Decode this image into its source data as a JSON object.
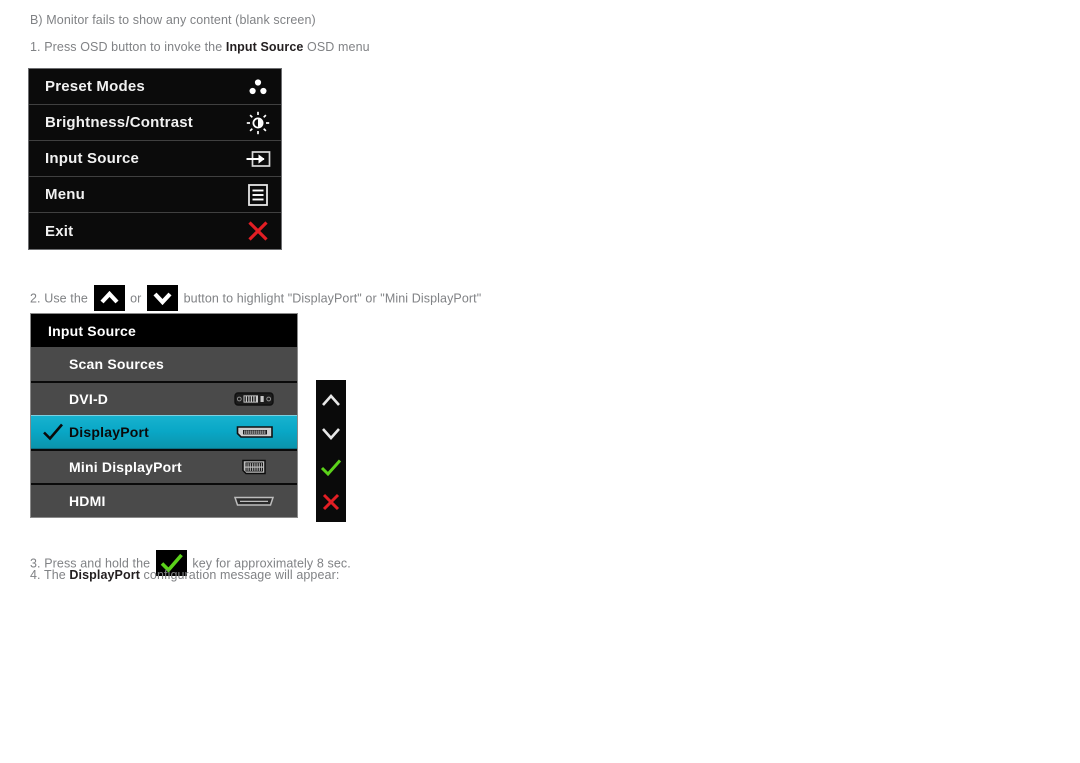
{
  "document": {
    "section_heading": "B) Monitor fails to show any content (blank screen)",
    "steps": {
      "step1": {
        "prefix": "1. Press OSD button to invoke the ",
        "bold": "Input Source",
        "suffix": " OSD menu"
      },
      "step2": {
        "prefix": "2. Use the ",
        "middle": " or ",
        "suffix": " button to highlight \"DisplayPort\" or \"Mini DisplayPort\""
      },
      "step3": {
        "prefix": "3. Press and hold the ",
        "suffix": " key for approximately 8 sec."
      },
      "step4": {
        "prefix": "4. The ",
        "bold": "DisplayPort",
        "suffix": " configuration message will appear:"
      }
    }
  },
  "osd_main_menu": {
    "items": [
      {
        "label": "Preset Modes",
        "icon": "preset-modes-icon"
      },
      {
        "label": "Brightness/Contrast",
        "icon": "brightness-contrast-icon"
      },
      {
        "label": "Input Source",
        "icon": "input-source-icon"
      },
      {
        "label": "Menu",
        "icon": "menu-lines-icon"
      },
      {
        "label": "Exit",
        "icon": "exit-x-icon"
      }
    ]
  },
  "input_source_menu": {
    "title": "Input Source",
    "items": [
      {
        "label": "Scan Sources",
        "connector": "none",
        "selected": false,
        "checked": false
      },
      {
        "label": "DVI-D",
        "connector": "dvi-d-icon",
        "selected": false,
        "checked": false
      },
      {
        "label": "DisplayPort",
        "connector": "displayport-icon",
        "selected": true,
        "checked": true
      },
      {
        "label": "Mini DisplayPort",
        "connector": "mini-displayport-icon",
        "selected": false,
        "checked": false
      },
      {
        "label": "HDMI",
        "connector": "hdmi-icon",
        "selected": false,
        "checked": false
      }
    ]
  },
  "key_strip": {
    "keys": [
      {
        "name": "up-chevron-key",
        "glyph": "chevron-up-icon"
      },
      {
        "name": "down-chevron-key",
        "glyph": "chevron-down-icon"
      },
      {
        "name": "ok-key",
        "glyph": "check-icon"
      },
      {
        "name": "exit-key",
        "glyph": "x-icon"
      }
    ]
  },
  "colors": {
    "highlight_cyan": "#09a7c6",
    "menu_row_gray": "#4a4a4a",
    "menu_black": "#0b0b0b",
    "text_gray": "#808285",
    "text_dark": "#231f20",
    "green_check": "#5bd21a",
    "red_x": "#e31e24"
  }
}
